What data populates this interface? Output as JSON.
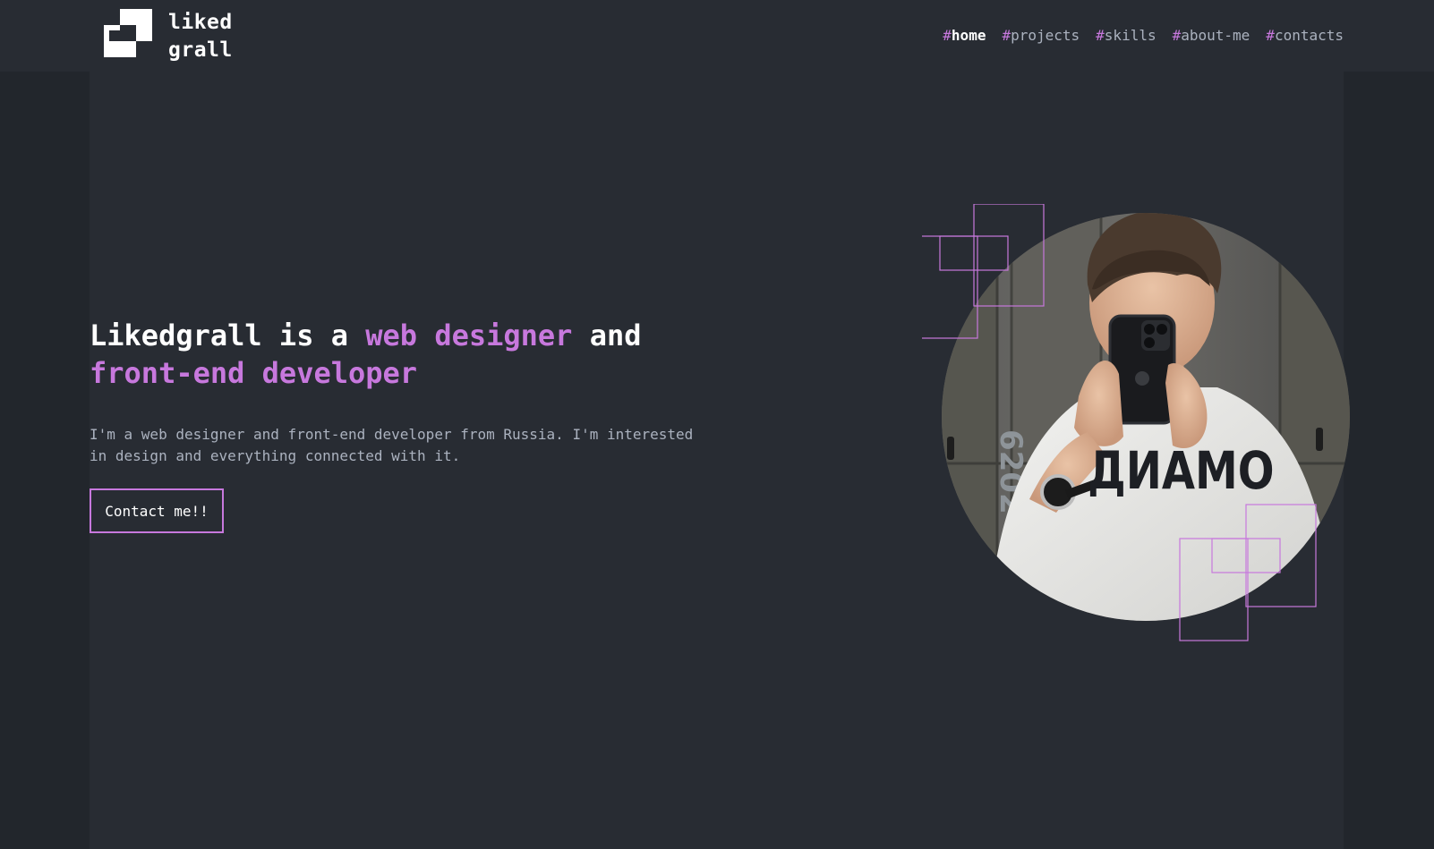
{
  "brand": {
    "line1": "liked",
    "line2": "grall",
    "colors": {
      "accent": "#c778dd",
      "background": "#282c33",
      "text": "#ffffff",
      "muted": "#abb2bf"
    }
  },
  "nav": {
    "items": [
      {
        "hash": "#",
        "label": "home",
        "active": true
      },
      {
        "hash": "#",
        "label": "projects"
      },
      {
        "hash": "#",
        "label": "skills"
      },
      {
        "hash": "#",
        "label": "about-me"
      },
      {
        "hash": "#",
        "label": "contacts"
      }
    ]
  },
  "hero": {
    "title_part1": "Likedgrall is a ",
    "title_accent1": "web designer",
    "title_part2": " and",
    "title_accent2": "front-end developer",
    "description": "I'm a web designer and front-end developer from Russia. I'm interested in design and everything connected with it.",
    "cta_label": "Contact me!!"
  },
  "photo": {
    "shirt_text": "ДИАМО",
    "locker_number": "6202"
  }
}
